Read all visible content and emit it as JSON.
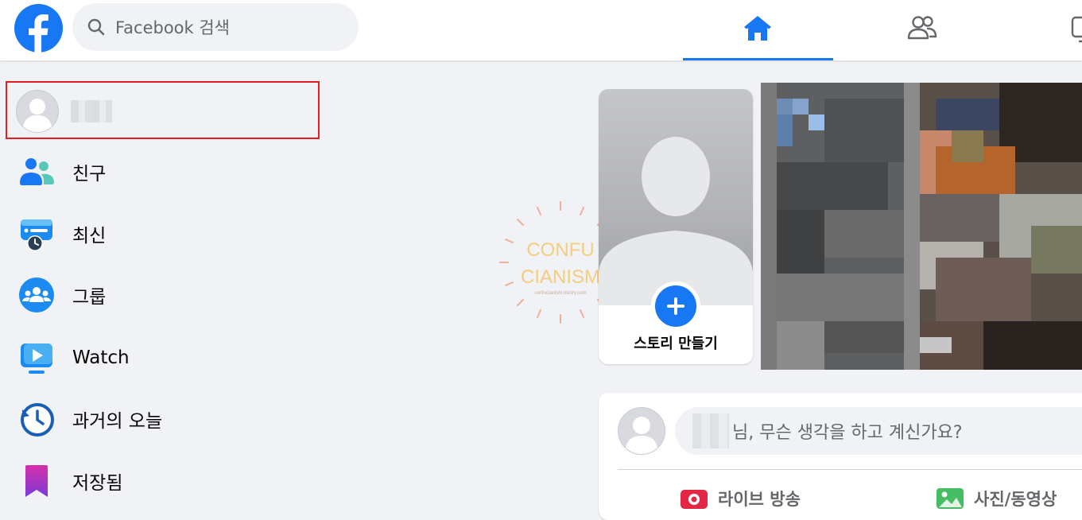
{
  "topbar": {
    "search_placeholder": "Facebook 검색"
  },
  "left_menu": {
    "items": [
      {
        "label": "친구",
        "icon": "friends-icon"
      },
      {
        "label": "최신",
        "icon": "most-recent-icon"
      },
      {
        "label": "그룹",
        "icon": "groups-icon"
      },
      {
        "label": "Watch",
        "icon": "watch-icon"
      },
      {
        "label": "과거의 오늘",
        "icon": "memories-icon"
      },
      {
        "label": "저장됨",
        "icon": "saved-icon"
      }
    ]
  },
  "watermark": {
    "line1": "CONFU",
    "line2": "CIANISM",
    "url": "confucianism.tistory.com"
  },
  "stories": {
    "create_label": "스토리 만들기"
  },
  "composer": {
    "prompt": "님, 무슨 생각을 하고 계신가요?",
    "actions": [
      {
        "label": "라이브 방송",
        "icon": "live-video-icon"
      },
      {
        "label": "사진/동영상",
        "icon": "photo-video-icon"
      }
    ]
  },
  "colors": {
    "brand": "#1877f2",
    "highlight_box": "#e41e1e"
  }
}
